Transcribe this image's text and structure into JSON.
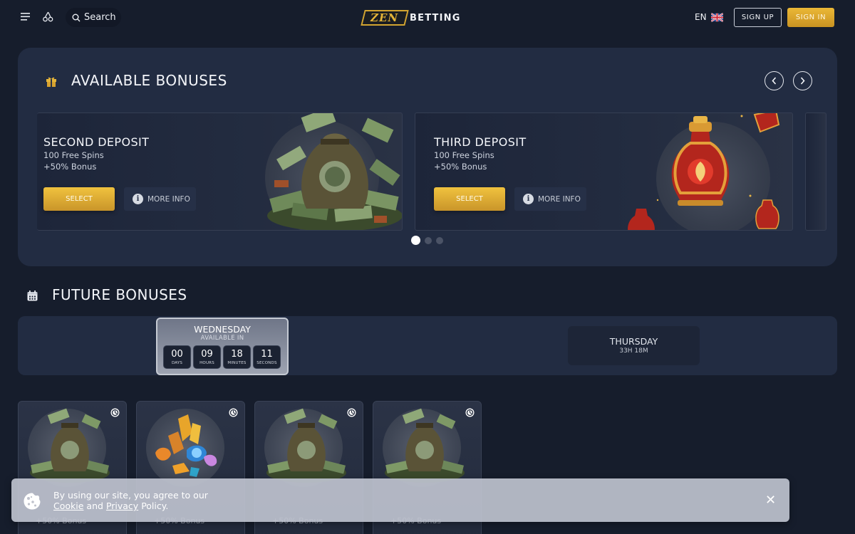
{
  "header": {
    "search_label": "Search",
    "logo_zen": "ZEN",
    "logo_betting": "BETTING",
    "language": "EN",
    "signup_label": "SIGN UP",
    "signin_label": "SIGN IN"
  },
  "available": {
    "title": "AVAILABLE BONUSES",
    "cards": [
      {
        "title": "SECOND DEPOSIT",
        "line1": "100 Free Spins",
        "line2": "+50% Bonus",
        "select_label": "SELECT",
        "more_label": "MORE INFO"
      },
      {
        "title": "THIRD DEPOSIT",
        "line1": "100 Free Spins",
        "line2": "+50% Bonus",
        "select_label": "SELECT",
        "more_label": "MORE INFO"
      }
    ],
    "active_dot": 1,
    "dot_count": 3
  },
  "future": {
    "title": "FUTURE BONUSES",
    "active_day": {
      "name": "WEDNESDAY",
      "subtitle": "AVAILABLE IN",
      "countdown": [
        {
          "value": "00",
          "unit": "DAYS"
        },
        {
          "value": "09",
          "unit": "HOURS"
        },
        {
          "value": "18",
          "unit": "MINUTES"
        },
        {
          "value": "11",
          "unit": "SECONDS"
        }
      ]
    },
    "next_day": {
      "name": "THURSDAY",
      "time": "33H 18M"
    },
    "mini_cards": [
      {
        "bottom": "+50% Bonus",
        "art": "money-bag"
      },
      {
        "bottom": "+50% Bonus",
        "art": "gems"
      },
      {
        "bottom": "+50% Bonus",
        "art": "money-bag"
      },
      {
        "bottom": "+50% Bonus",
        "art": "money-bag"
      }
    ]
  },
  "cookie": {
    "line1": "By using our site, you agree to our",
    "link_cookie": "Cookie",
    "and": "and",
    "link_privacy": "Privacy",
    "policy": "Policy.",
    "close": "✕"
  },
  "colors": {
    "background": "#161d2c",
    "panel": "#222c42",
    "gold": "#e4b437",
    "accent_button": "#ebb836"
  }
}
